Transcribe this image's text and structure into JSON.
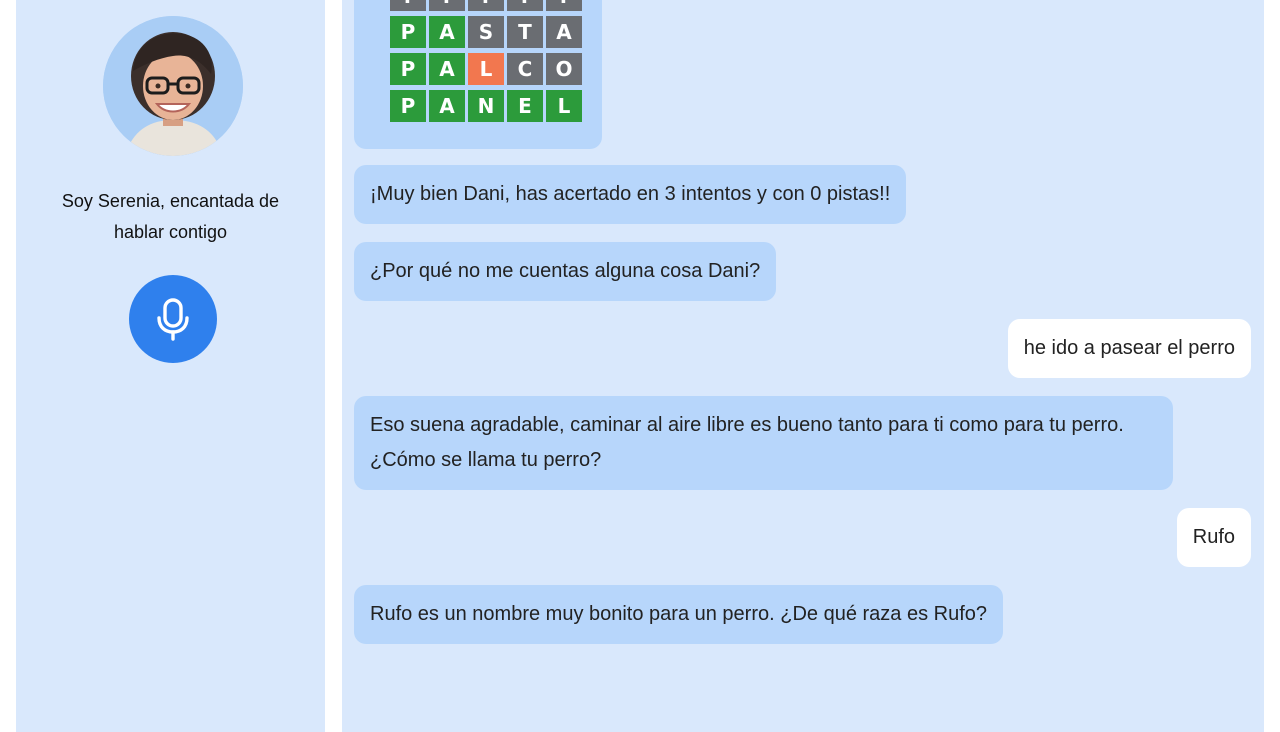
{
  "sidebar": {
    "intro_line1": "Soy Serenia, encantada de",
    "intro_line2": "hablar contigo",
    "mic_icon": "microphone-icon",
    "accent_color": "#2f80ed"
  },
  "game": {
    "rows": [
      {
        "letters": [
          "?",
          "?",
          "?",
          "?",
          "?"
        ],
        "states": [
          "dark",
          "dark",
          "dark",
          "dark",
          "dark"
        ]
      },
      {
        "letters": [
          "P",
          "A",
          "S",
          "T",
          "A"
        ],
        "states": [
          "green",
          "green",
          "dark",
          "dark",
          "dark"
        ]
      },
      {
        "letters": [
          "P",
          "A",
          "L",
          "C",
          "O"
        ],
        "states": [
          "green",
          "green",
          "orange",
          "dark",
          "dark"
        ]
      },
      {
        "letters": [
          "P",
          "A",
          "N",
          "E",
          "L"
        ],
        "states": [
          "green",
          "green",
          "green",
          "green",
          "green"
        ]
      }
    ]
  },
  "messages": [
    {
      "from": "bot",
      "text": "¡Muy bien Dani, has acertado en 3 intentos y con 0 pistas!!"
    },
    {
      "from": "bot",
      "text": "¿Por qué no me cuentas alguna cosa Dani?"
    },
    {
      "from": "user",
      "text": "he ido a pasear el perro"
    },
    {
      "from": "bot",
      "text": "Eso suena agradable, caminar al aire libre es bueno tanto para ti como para tu perro. ¿Cómo se llama tu perro?"
    },
    {
      "from": "user",
      "text": "Rufo"
    },
    {
      "from": "bot",
      "text": "Rufo es un nombre muy bonito para un perro. ¿De qué raza es Rufo?"
    }
  ]
}
